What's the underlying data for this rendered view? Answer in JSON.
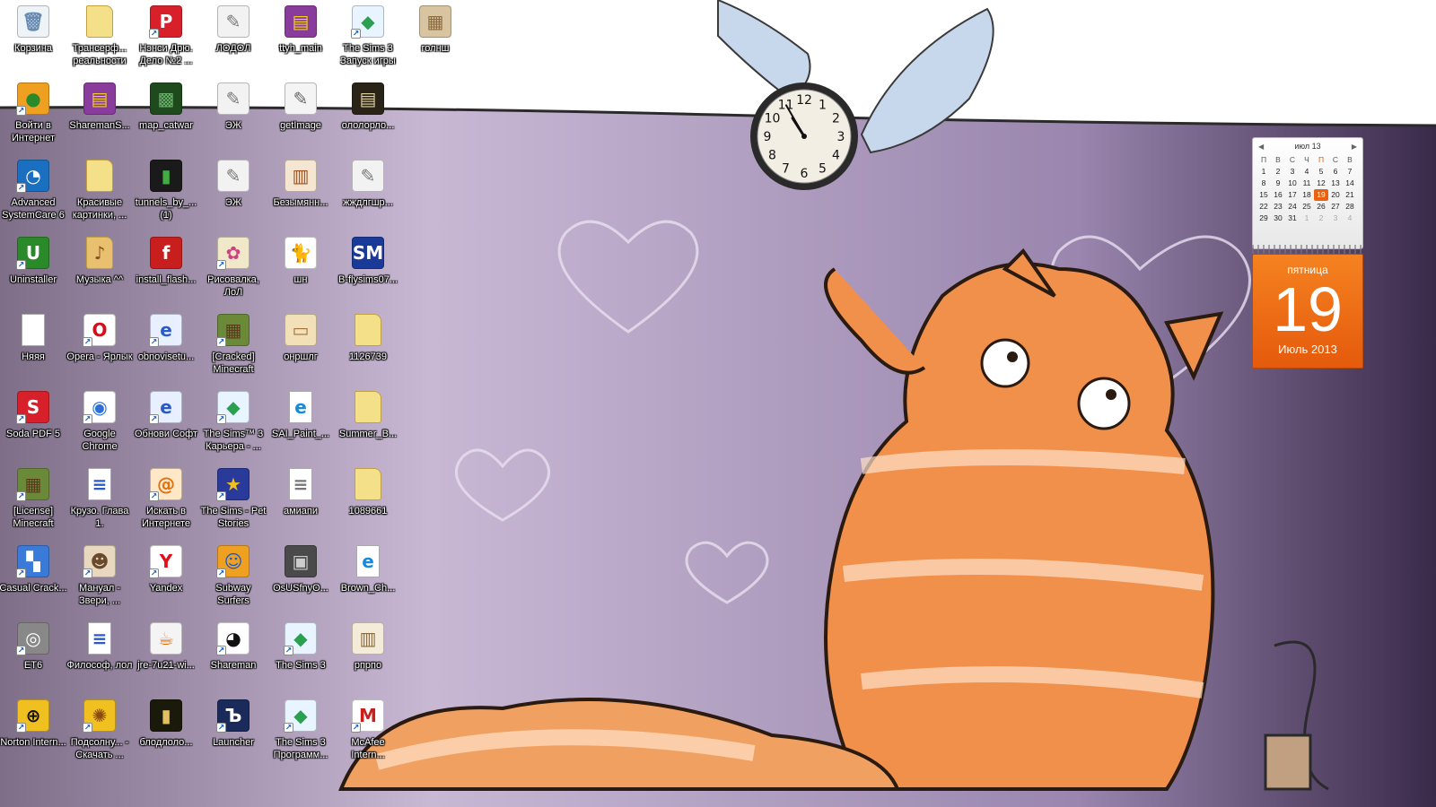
{
  "desktop": {
    "icons": [
      {
        "label": "Корзина",
        "icon": "recycle-bin-icon",
        "bg": "#eef3f8",
        "fg": "#6a8bb0",
        "glyph": "🗑",
        "shortcut": false
      },
      {
        "label": "Трансерф... реальности",
        "icon": "folder-icon",
        "bg": "#f5e08a",
        "fg": "#b08c20",
        "glyph": "",
        "shortcut": false
      },
      {
        "label": "Нэнси Дрю. Дело №2 ...",
        "icon": "nancy-drew-icon",
        "bg": "#d8202a",
        "fg": "#ffffff",
        "glyph": "P",
        "shortcut": true
      },
      {
        "label": "ЛОДОЛ",
        "icon": "sketch-image-icon",
        "bg": "#f2f2f2",
        "fg": "#777",
        "glyph": "✎",
        "shortcut": false
      },
      {
        "label": "ttyh_main",
        "icon": "winrar-archive-icon",
        "bg": "#8a3c9c",
        "fg": "#f0d020",
        "glyph": "▤",
        "shortcut": false
      },
      {
        "label": "The Sims 3 Запуск игры",
        "icon": "sims-plumbob-icon",
        "bg": "#e8f4ff",
        "fg": "#2aa050",
        "glyph": "◆",
        "shortcut": true
      },
      {
        "label": "голнш",
        "icon": "image-file-icon",
        "bg": "#d8c4a0",
        "fg": "#8a6a40",
        "glyph": "▦",
        "shortcut": false
      },
      {
        "label": "Войти в Интернет",
        "icon": "internet-connect-icon",
        "bg": "#f0a020",
        "fg": "#2a8a2a",
        "glyph": "●",
        "shortcut": true
      },
      {
        "label": "SharemanS...",
        "icon": "winrar-archive-icon",
        "bg": "#8a3c9c",
        "fg": "#f0d020",
        "glyph": "▤",
        "shortcut": false
      },
      {
        "label": "map_catwar",
        "icon": "map-image-icon",
        "bg": "#1e4a1e",
        "fg": "#6ab06a",
        "glyph": "▩",
        "shortcut": false
      },
      {
        "label": "ЭЖ",
        "icon": "sketch-image-icon",
        "bg": "#f2f2f2",
        "fg": "#777",
        "glyph": "✎",
        "shortcut": false
      },
      {
        "label": "getImage",
        "icon": "sketch-image-icon",
        "bg": "#f4f4f4",
        "fg": "#666",
        "glyph": "✎",
        "shortcut": false
      },
      {
        "label": "ололорло...",
        "icon": "image-file-icon",
        "bg": "#2a2418",
        "fg": "#e0d0a0",
        "glyph": "▤",
        "shortcut": false
      },
      {
        "label": "Advanced SystemCare 6",
        "icon": "advanced-systemcare-icon",
        "bg": "#1a6fc0",
        "fg": "#ffffff",
        "glyph": "◔",
        "shortcut": true
      },
      {
        "label": "Красивые картинки, ...",
        "icon": "folder-icon",
        "bg": "#f5e08a",
        "fg": "#b08c20",
        "glyph": "",
        "shortcut": false
      },
      {
        "label": "tunnels_by_... (1)",
        "icon": "dark-image-icon",
        "bg": "#1a1a1a",
        "fg": "#44aa44",
        "glyph": "▮",
        "shortcut": false
      },
      {
        "label": "ЭЖ",
        "icon": "sketch-image-icon",
        "bg": "#f2f2f2",
        "fg": "#777",
        "glyph": "✎",
        "shortcut": false
      },
      {
        "label": "Безымянн...",
        "icon": "screenshot-image-icon",
        "bg": "#f4e6d0",
        "fg": "#a05020",
        "glyph": "▥",
        "shortcut": false
      },
      {
        "label": "жждлгшр...",
        "icon": "sketch-image-icon",
        "bg": "#f2f2f2",
        "fg": "#777",
        "glyph": "✎",
        "shortcut": false
      },
      {
        "label": "Uninstaller",
        "icon": "uninstaller-icon",
        "bg": "#2a8a2a",
        "fg": "#ffffff",
        "glyph": "U",
        "shortcut": true
      },
      {
        "label": "Музыка ^^",
        "icon": "music-folder-icon",
        "bg": "#e8c070",
        "fg": "#8a5020",
        "glyph": "♪",
        "shortcut": false
      },
      {
        "label": "install_flash...",
        "icon": "flash-installer-icon",
        "bg": "#c81e1e",
        "fg": "#ffffff",
        "glyph": "f",
        "shortcut": false
      },
      {
        "label": "Рисовалка, ЛоЛ",
        "icon": "paint-palette-icon",
        "bg": "#f0e8c8",
        "fg": "#d04080",
        "glyph": "✿",
        "shortcut": true
      },
      {
        "label": "шн",
        "icon": "cat-image-icon",
        "bg": "#ffffff",
        "fg": "#111",
        "glyph": "🐈",
        "shortcut": false
      },
      {
        "label": "B-flysims07...",
        "icon": "flysims-icon",
        "bg": "#1a3a9a",
        "fg": "#ffffff",
        "glyph": "SM",
        "shortcut": false
      },
      {
        "label": "Няяя",
        "icon": "blank-file-icon",
        "bg": "#ffffff",
        "fg": "#999",
        "glyph": "",
        "shortcut": false
      },
      {
        "label": "Opera - Ярлык",
        "icon": "opera-browser-icon",
        "bg": "#ffffff",
        "fg": "#d0101a",
        "glyph": "O",
        "shortcut": true
      },
      {
        "label": "obnovisetu...",
        "icon": "ie-update-icon",
        "bg": "#e8f0ff",
        "fg": "#2a5ac8",
        "glyph": "e",
        "shortcut": true
      },
      {
        "label": "[Cracked] Minecraft",
        "icon": "minecraft-grass-icon",
        "bg": "#6a8a3a",
        "fg": "#5a3a1a",
        "glyph": "▦",
        "shortcut": true
      },
      {
        "label": "онршлг",
        "icon": "image-file-icon",
        "bg": "#f2e0b8",
        "fg": "#a07040",
        "glyph": "▭",
        "shortcut": false
      },
      {
        "label": "1126739",
        "icon": "folder-icon",
        "bg": "#f5e08a",
        "fg": "#b08c20",
        "glyph": "",
        "shortcut": false
      },
      {
        "label": "Soda PDF 5",
        "icon": "soda-pdf-icon",
        "bg": "#d8202a",
        "fg": "#ffffff",
        "glyph": "S",
        "shortcut": true
      },
      {
        "label": "Google Chrome",
        "icon": "chrome-icon",
        "bg": "#ffffff",
        "fg": "#2a70d8",
        "glyph": "◉",
        "shortcut": true
      },
      {
        "label": "Обнови Софт",
        "icon": "ie-update-icon",
        "bg": "#e8f0ff",
        "fg": "#2a5ac8",
        "glyph": "e",
        "shortcut": true
      },
      {
        "label": "The Sims™ 3 Карьера - ...",
        "icon": "sims-plumbob-icon",
        "bg": "#e8f4ff",
        "fg": "#2aa050",
        "glyph": "◆",
        "shortcut": true
      },
      {
        "label": "SAI_Paint_...",
        "icon": "html-document-icon",
        "bg": "#ffffff",
        "fg": "#1a8ad8",
        "glyph": "e",
        "shortcut": false
      },
      {
        "label": "Summer_B...",
        "icon": "folder-icon",
        "bg": "#f5e08a",
        "fg": "#b08c20",
        "glyph": "",
        "shortcut": false
      },
      {
        "label": "[License] Minecraft",
        "icon": "minecraft-grass-icon",
        "bg": "#6a8a3a",
        "fg": "#5a3a1a",
        "glyph": "▦",
        "shortcut": true
      },
      {
        "label": "Крузо. Глава 1.",
        "icon": "word-document-icon",
        "bg": "#ffffff",
        "fg": "#2a5ac8",
        "glyph": "≡",
        "shortcut": false
      },
      {
        "label": "Искать в Интернете",
        "icon": "search-internet-icon",
        "bg": "#ffe8c8",
        "fg": "#e07010",
        "glyph": "@",
        "shortcut": true
      },
      {
        "label": "The Sims - Pet Stories",
        "icon": "sims-pet-stories-icon",
        "bg": "#2a3a9a",
        "fg": "#f0c020",
        "glyph": "★",
        "shortcut": true
      },
      {
        "label": "амиапи",
        "icon": "text-document-icon",
        "bg": "#ffffff",
        "fg": "#777",
        "glyph": "≡",
        "shortcut": false
      },
      {
        "label": "1089661",
        "icon": "folder-icon",
        "bg": "#f5e08a",
        "fg": "#b08c20",
        "glyph": "",
        "shortcut": false
      },
      {
        "label": "Casual Crack...",
        "icon": "casual-crack-icon",
        "bg": "#3a7ad8",
        "fg": "#ffffff",
        "glyph": "▚",
        "shortcut": true
      },
      {
        "label": "Мануал - Звери, ...",
        "icon": "manual-icon",
        "bg": "#e8d8c0",
        "fg": "#6a4a2a",
        "glyph": "☻",
        "shortcut": true
      },
      {
        "label": "Yandex",
        "icon": "yandex-browser-icon",
        "bg": "#ffffff",
        "fg": "#e0101a",
        "glyph": "Y",
        "shortcut": true
      },
      {
        "label": "Subway Surfers",
        "icon": "subway-surfers-icon",
        "bg": "#f0a020",
        "fg": "#1a5ac8",
        "glyph": "☺",
        "shortcut": true
      },
      {
        "label": "OsUSfnyO...",
        "icon": "photo-image-icon",
        "bg": "#4a4a4a",
        "fg": "#cccccc",
        "glyph": "▣",
        "shortcut": false
      },
      {
        "label": "Brown_Ch...",
        "icon": "html-document-icon",
        "bg": "#ffffff",
        "fg": "#1a8ad8",
        "glyph": "e",
        "shortcut": false
      },
      {
        "label": "ET6",
        "icon": "et6-icon",
        "bg": "#888888",
        "fg": "#ffffff",
        "glyph": "◎",
        "shortcut": true
      },
      {
        "label": "Философ, лол",
        "icon": "word-document-icon",
        "bg": "#ffffff",
        "fg": "#2a5ac8",
        "glyph": "≡",
        "shortcut": false
      },
      {
        "label": "jre-7u21-wi...",
        "icon": "java-installer-icon",
        "bg": "#f4f4f4",
        "fg": "#e07010",
        "glyph": "☕",
        "shortcut": false
      },
      {
        "label": "Shareman",
        "icon": "shareman-icon",
        "bg": "#ffffff",
        "fg": "#111111",
        "glyph": "◕",
        "shortcut": true
      },
      {
        "label": "The Sims 3",
        "icon": "sims-plumbob-icon",
        "bg": "#e8f4ff",
        "fg": "#2aa050",
        "glyph": "◆",
        "shortcut": true
      },
      {
        "label": "рпрпо",
        "icon": "comic-image-icon",
        "bg": "#f4ecd8",
        "fg": "#8a6a40",
        "glyph": "▥",
        "shortcut": false
      },
      {
        "label": "Norton Intern...",
        "icon": "norton-icon",
        "bg": "#f0c020",
        "fg": "#111111",
        "glyph": "⊕",
        "shortcut": true
      },
      {
        "label": "Подсолну... - Скачать ...",
        "icon": "sunflower-icon",
        "bg": "#f0c020",
        "fg": "#8a4a10",
        "glyph": "✺",
        "shortcut": true
      },
      {
        "label": "блодлоло...",
        "icon": "dark-image-icon",
        "bg": "#1a1a0a",
        "fg": "#e0c060",
        "glyph": "▮",
        "shortcut": false
      },
      {
        "label": "Launcher",
        "icon": "launcher-icon",
        "bg": "#1a2a5a",
        "fg": "#ffffff",
        "glyph": "Ъ",
        "shortcut": true
      },
      {
        "label": "The Sims 3 Программ...",
        "icon": "sims-plumbob-icon",
        "bg": "#e8f4ff",
        "fg": "#2aa050",
        "glyph": "◆",
        "shortcut": true
      },
      {
        "label": "McAfee Intern...",
        "icon": "mcafee-icon",
        "bg": "#ffffff",
        "fg": "#c81e1e",
        "glyph": "M",
        "shortcut": true
      }
    ]
  },
  "clock": {
    "numerals": [
      "12",
      "1",
      "2",
      "3",
      "4",
      "5",
      "6",
      "7",
      "8",
      "9",
      "10",
      "11"
    ],
    "hour": 10,
    "minute": 55
  },
  "calendar": {
    "header_month": "июл 13",
    "prev_arrow": "◀",
    "next_arrow": "▶",
    "weekdays": [
      "П",
      "В",
      "С",
      "Ч",
      "П",
      "С",
      "В"
    ],
    "weekday_highlight_index": 4,
    "days": [
      [
        "1",
        "2",
        "3",
        "4",
        "5",
        "6",
        "7"
      ],
      [
        "8",
        "9",
        "10",
        "11",
        "12",
        "13",
        "14"
      ],
      [
        "15",
        "16",
        "17",
        "18",
        "19",
        "20",
        "21"
      ],
      [
        "22",
        "23",
        "24",
        "25",
        "26",
        "27",
        "28"
      ],
      [
        "29",
        "30",
        "31",
        "1",
        "2",
        "3",
        "4"
      ]
    ],
    "other_month_from_index": 31,
    "today": "19",
    "weekday_name": "пятница",
    "day_number": "19",
    "month_year": "Июль 2013",
    "accent_color": "#e8620f"
  }
}
